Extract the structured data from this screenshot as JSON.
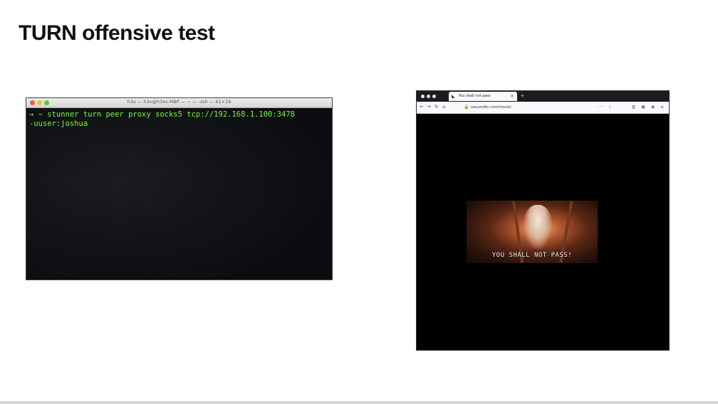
{
  "slide": {
    "title": "TURN offensive test"
  },
  "terminal": {
    "window_title": "h3x — h3x@h3xs-MBP — ~ — -zsh — 61×16",
    "lines": [
      "→  ~ stunner turn peer proxy socks5 tcp://192.168.1.100:3478",
      "-uuser:joshua"
    ]
  },
  "browser": {
    "tab_title": "You shall not pass",
    "tab_close": "×",
    "new_tab": "+",
    "url": "secureditc.com/movie/",
    "nav": {
      "back": "←",
      "forward": "→",
      "reload": "↻",
      "home": "⌂"
    },
    "video_subtitle": "YOU SHALL NOT PASS!"
  },
  "colors": {
    "terminal_text": "#7cf542",
    "terminal_bg": "#0b0d10",
    "browser_page_bg": "#000000"
  }
}
